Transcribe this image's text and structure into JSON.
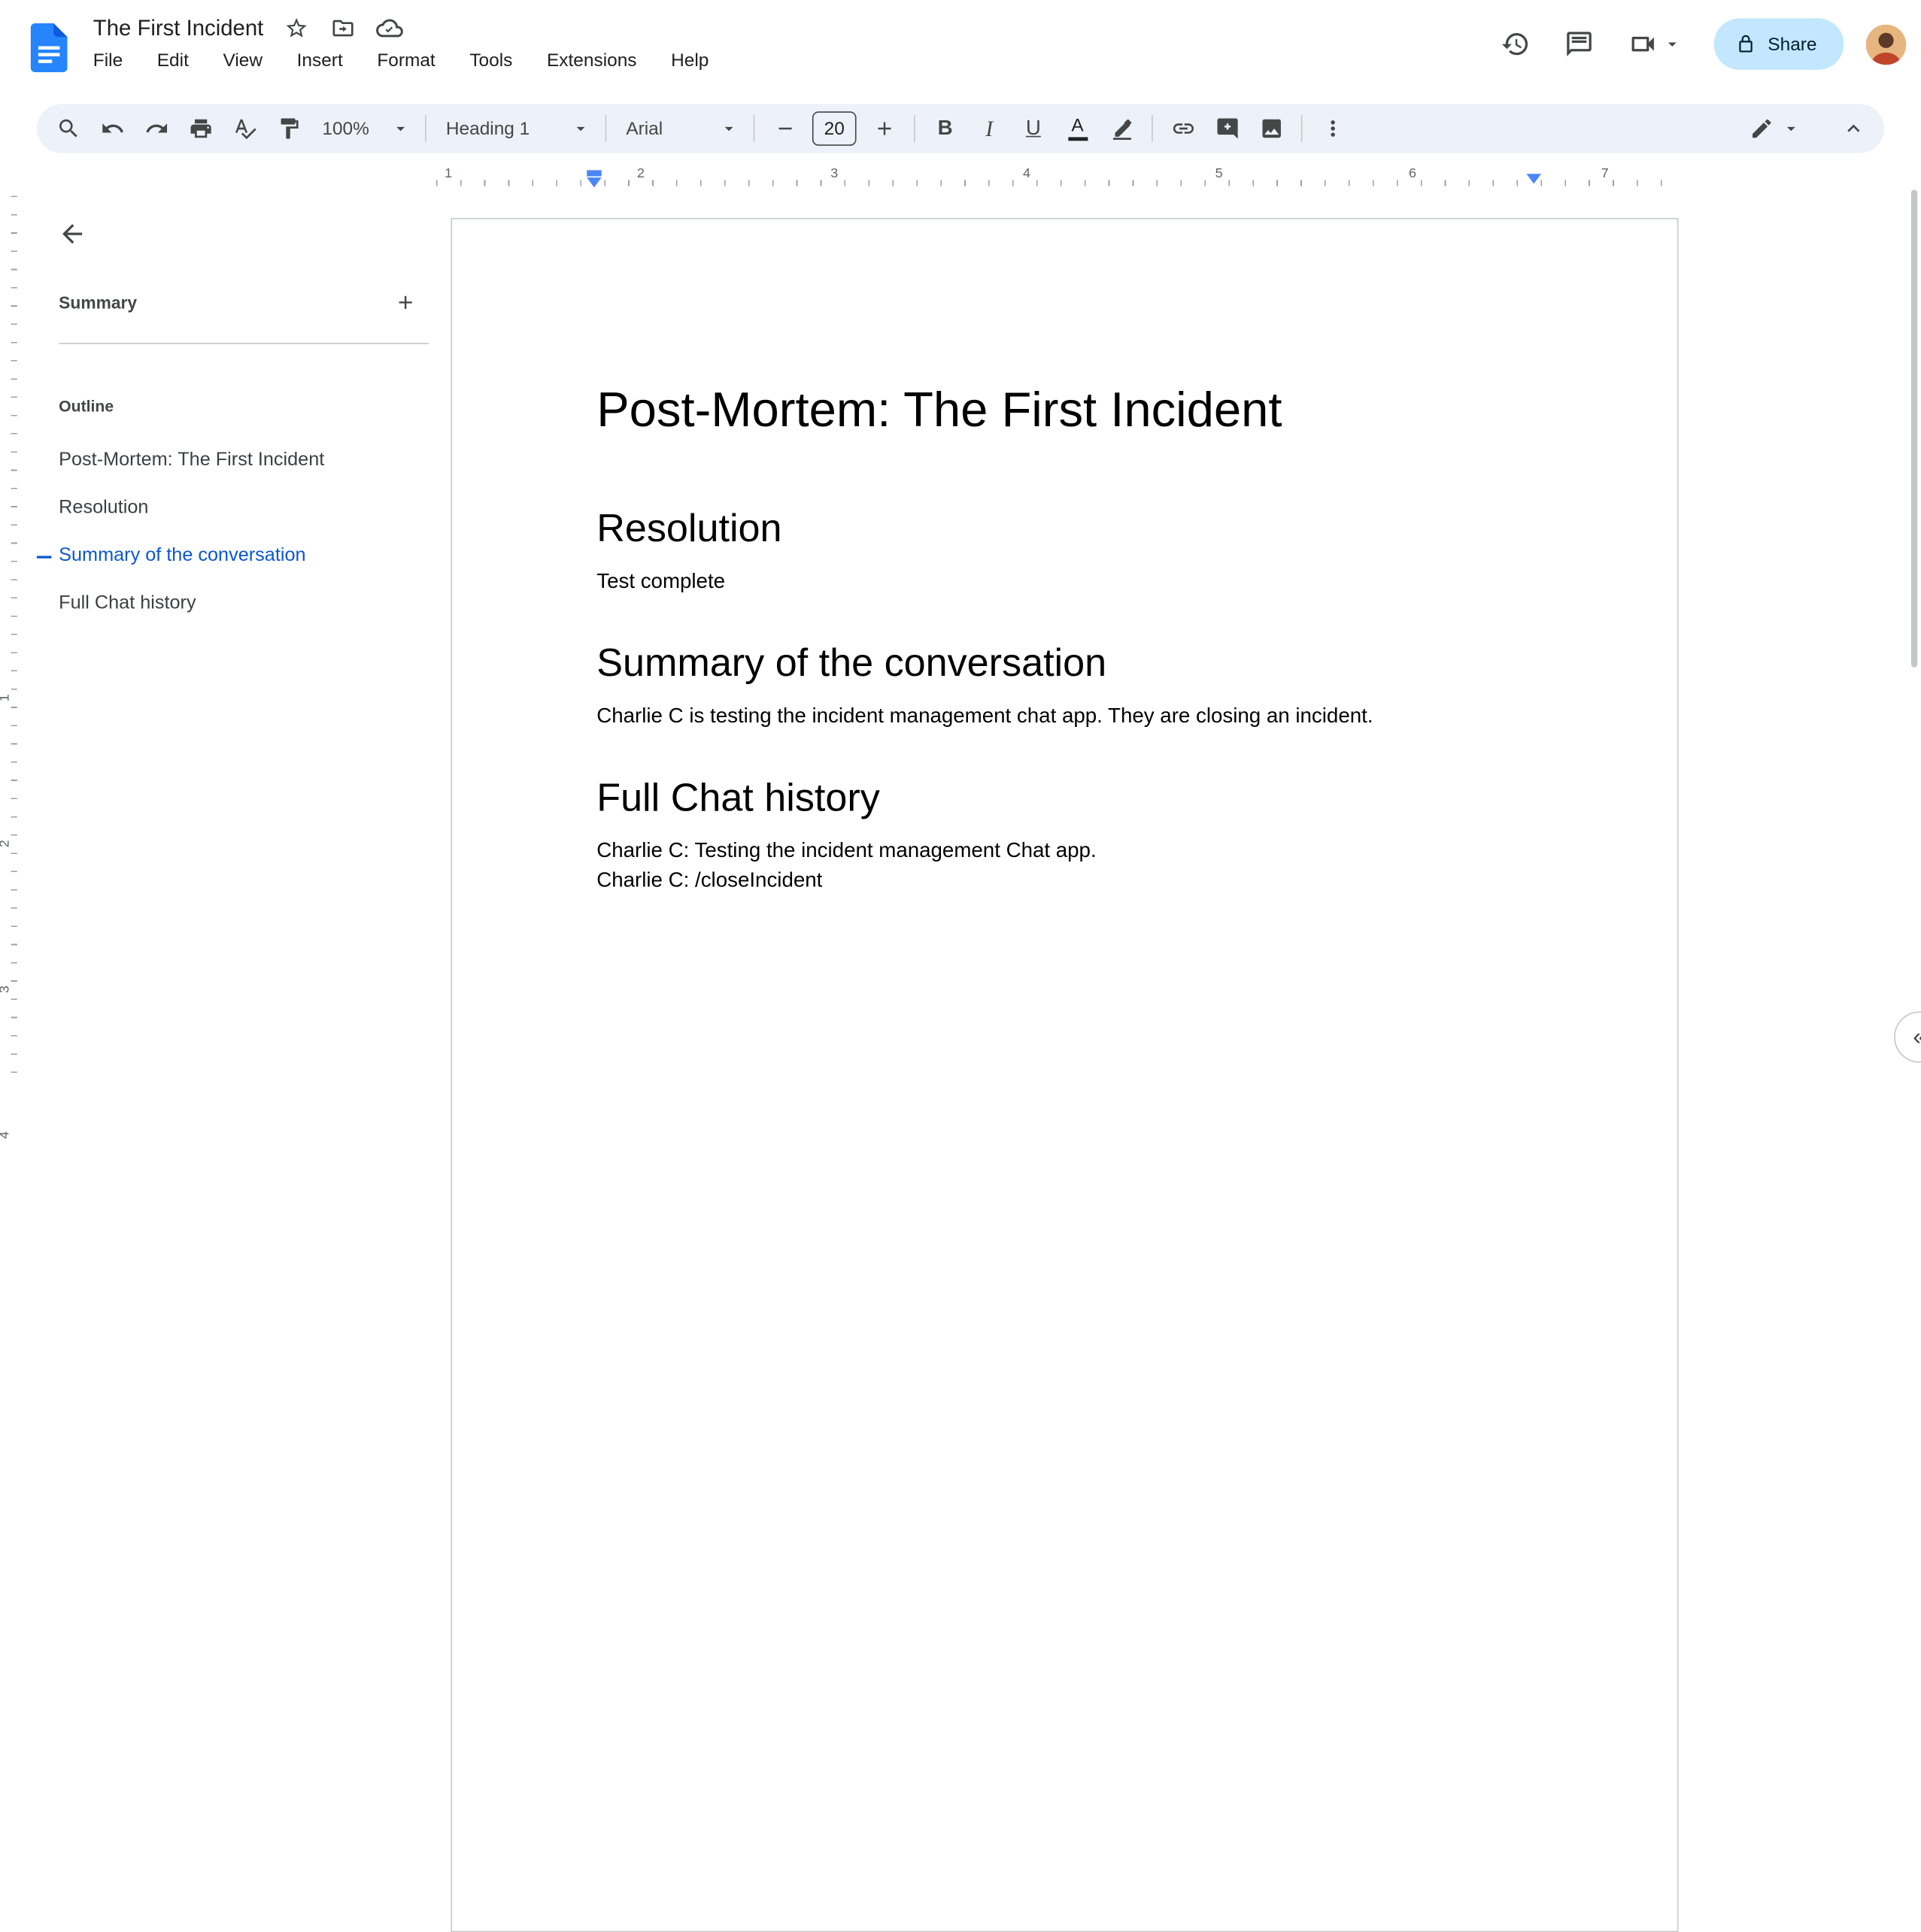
{
  "header": {
    "title": "The First Incident",
    "menus": [
      "File",
      "Edit",
      "View",
      "Insert",
      "Format",
      "Tools",
      "Extensions",
      "Help"
    ],
    "share_label": "Share"
  },
  "toolbar": {
    "zoom": "100%",
    "paragraph_style": "Heading 1",
    "font": "Arial",
    "font_size": "20",
    "bold_label": "B",
    "italic_label": "I",
    "underline_label": "U",
    "text_color_label": "A"
  },
  "ruler": {
    "horizontal_numbers": [
      "1",
      "2",
      "3",
      "4",
      "5",
      "6",
      "7"
    ],
    "vertical_numbers": [
      "1",
      "2",
      "3",
      "4"
    ]
  },
  "outline_panel": {
    "summary_label": "Summary",
    "outline_label": "Outline",
    "items": [
      {
        "label": "Post-Mortem: The First Incident",
        "active": false
      },
      {
        "label": "Resolution",
        "active": false
      },
      {
        "label": "Summary of the conversation",
        "active": true
      },
      {
        "label": "Full Chat history",
        "active": false
      }
    ]
  },
  "document": {
    "title": "Post-Mortem: The First Incident",
    "sections": [
      {
        "heading": "Resolution",
        "paragraphs": [
          "Test complete"
        ]
      },
      {
        "heading": "Summary of the conversation",
        "paragraphs": [
          "Charlie C is testing the incident management chat app. They are closing an incident."
        ]
      },
      {
        "heading": "Full Chat history",
        "paragraphs": [
          "Charlie C: Testing the incident management Chat app.",
          "Charlie C: /closeIncident"
        ]
      }
    ]
  },
  "colors": {
    "accent_blue": "#0b57d0",
    "share_bg": "#c2e7ff",
    "share_text": "#001d35",
    "toolbar_bg": "#edf2fa",
    "docs_logo_blue": "#2684fc",
    "indent_marker": "#4a86f5"
  }
}
